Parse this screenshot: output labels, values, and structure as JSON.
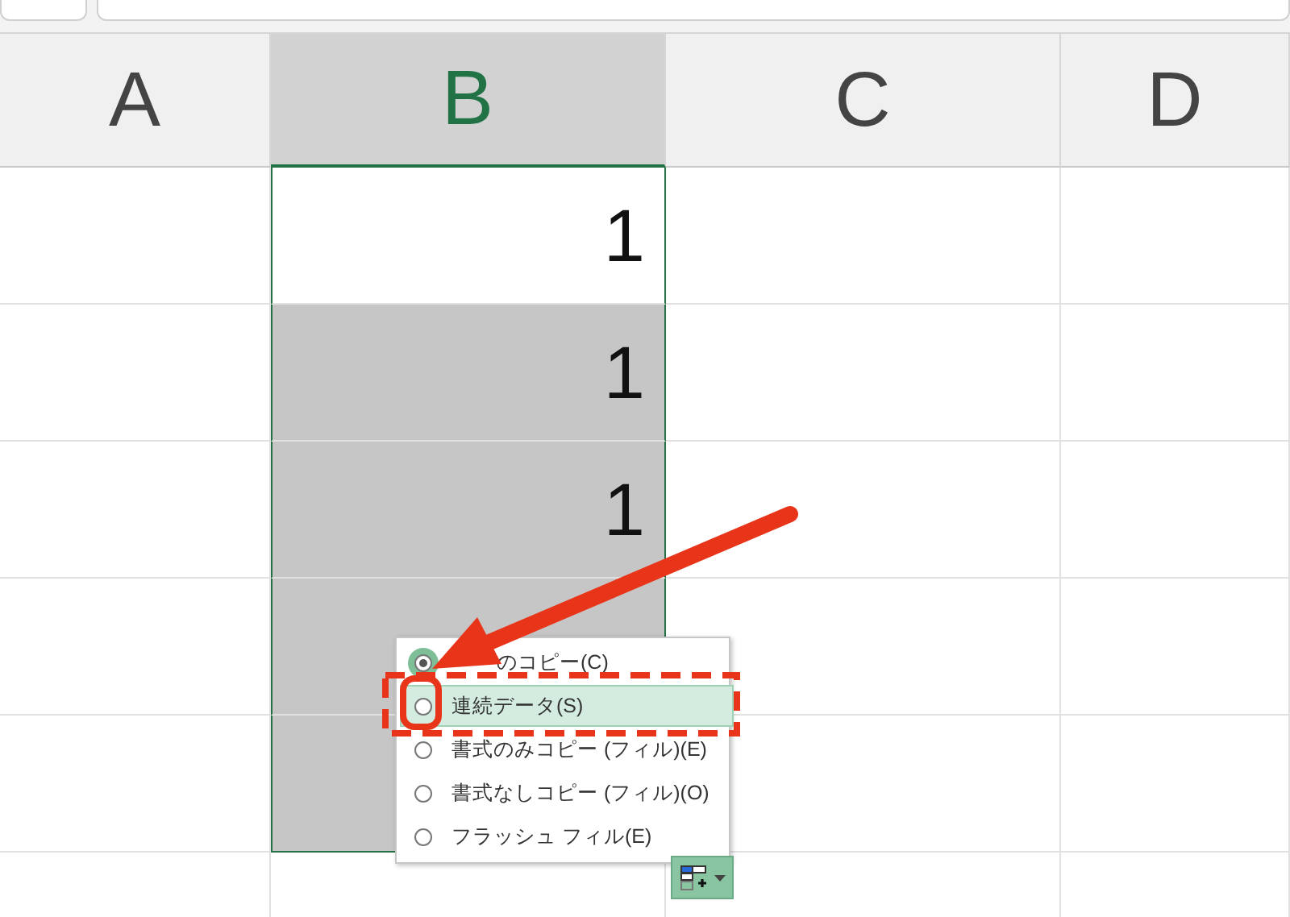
{
  "columns": [
    {
      "label": "A",
      "selected": false
    },
    {
      "label": "B",
      "selected": true
    },
    {
      "label": "C",
      "selected": false
    },
    {
      "label": "D",
      "selected": false
    }
  ],
  "rows": [
    {
      "b": "1",
      "selected": false
    },
    {
      "b": "1",
      "selected": true
    },
    {
      "b": "1",
      "selected": true
    },
    {
      "selected": true
    },
    {
      "selected": true
    },
    {
      "selected": false
    }
  ],
  "autofill_menu": {
    "items": [
      {
        "label": "のコピー(C)",
        "selected": true,
        "highlighted": false
      },
      {
        "label": "連続データ(S)",
        "selected": false,
        "highlighted": true
      },
      {
        "label": "書式のみコピー (フィル)(E)",
        "selected": false,
        "highlighted": false
      },
      {
        "label": "書式なしコピー (フィル)(O)",
        "selected": false,
        "highlighted": false
      },
      {
        "label": "フラッシュ フィル(E)",
        "selected": false,
        "highlighted": false
      }
    ]
  }
}
